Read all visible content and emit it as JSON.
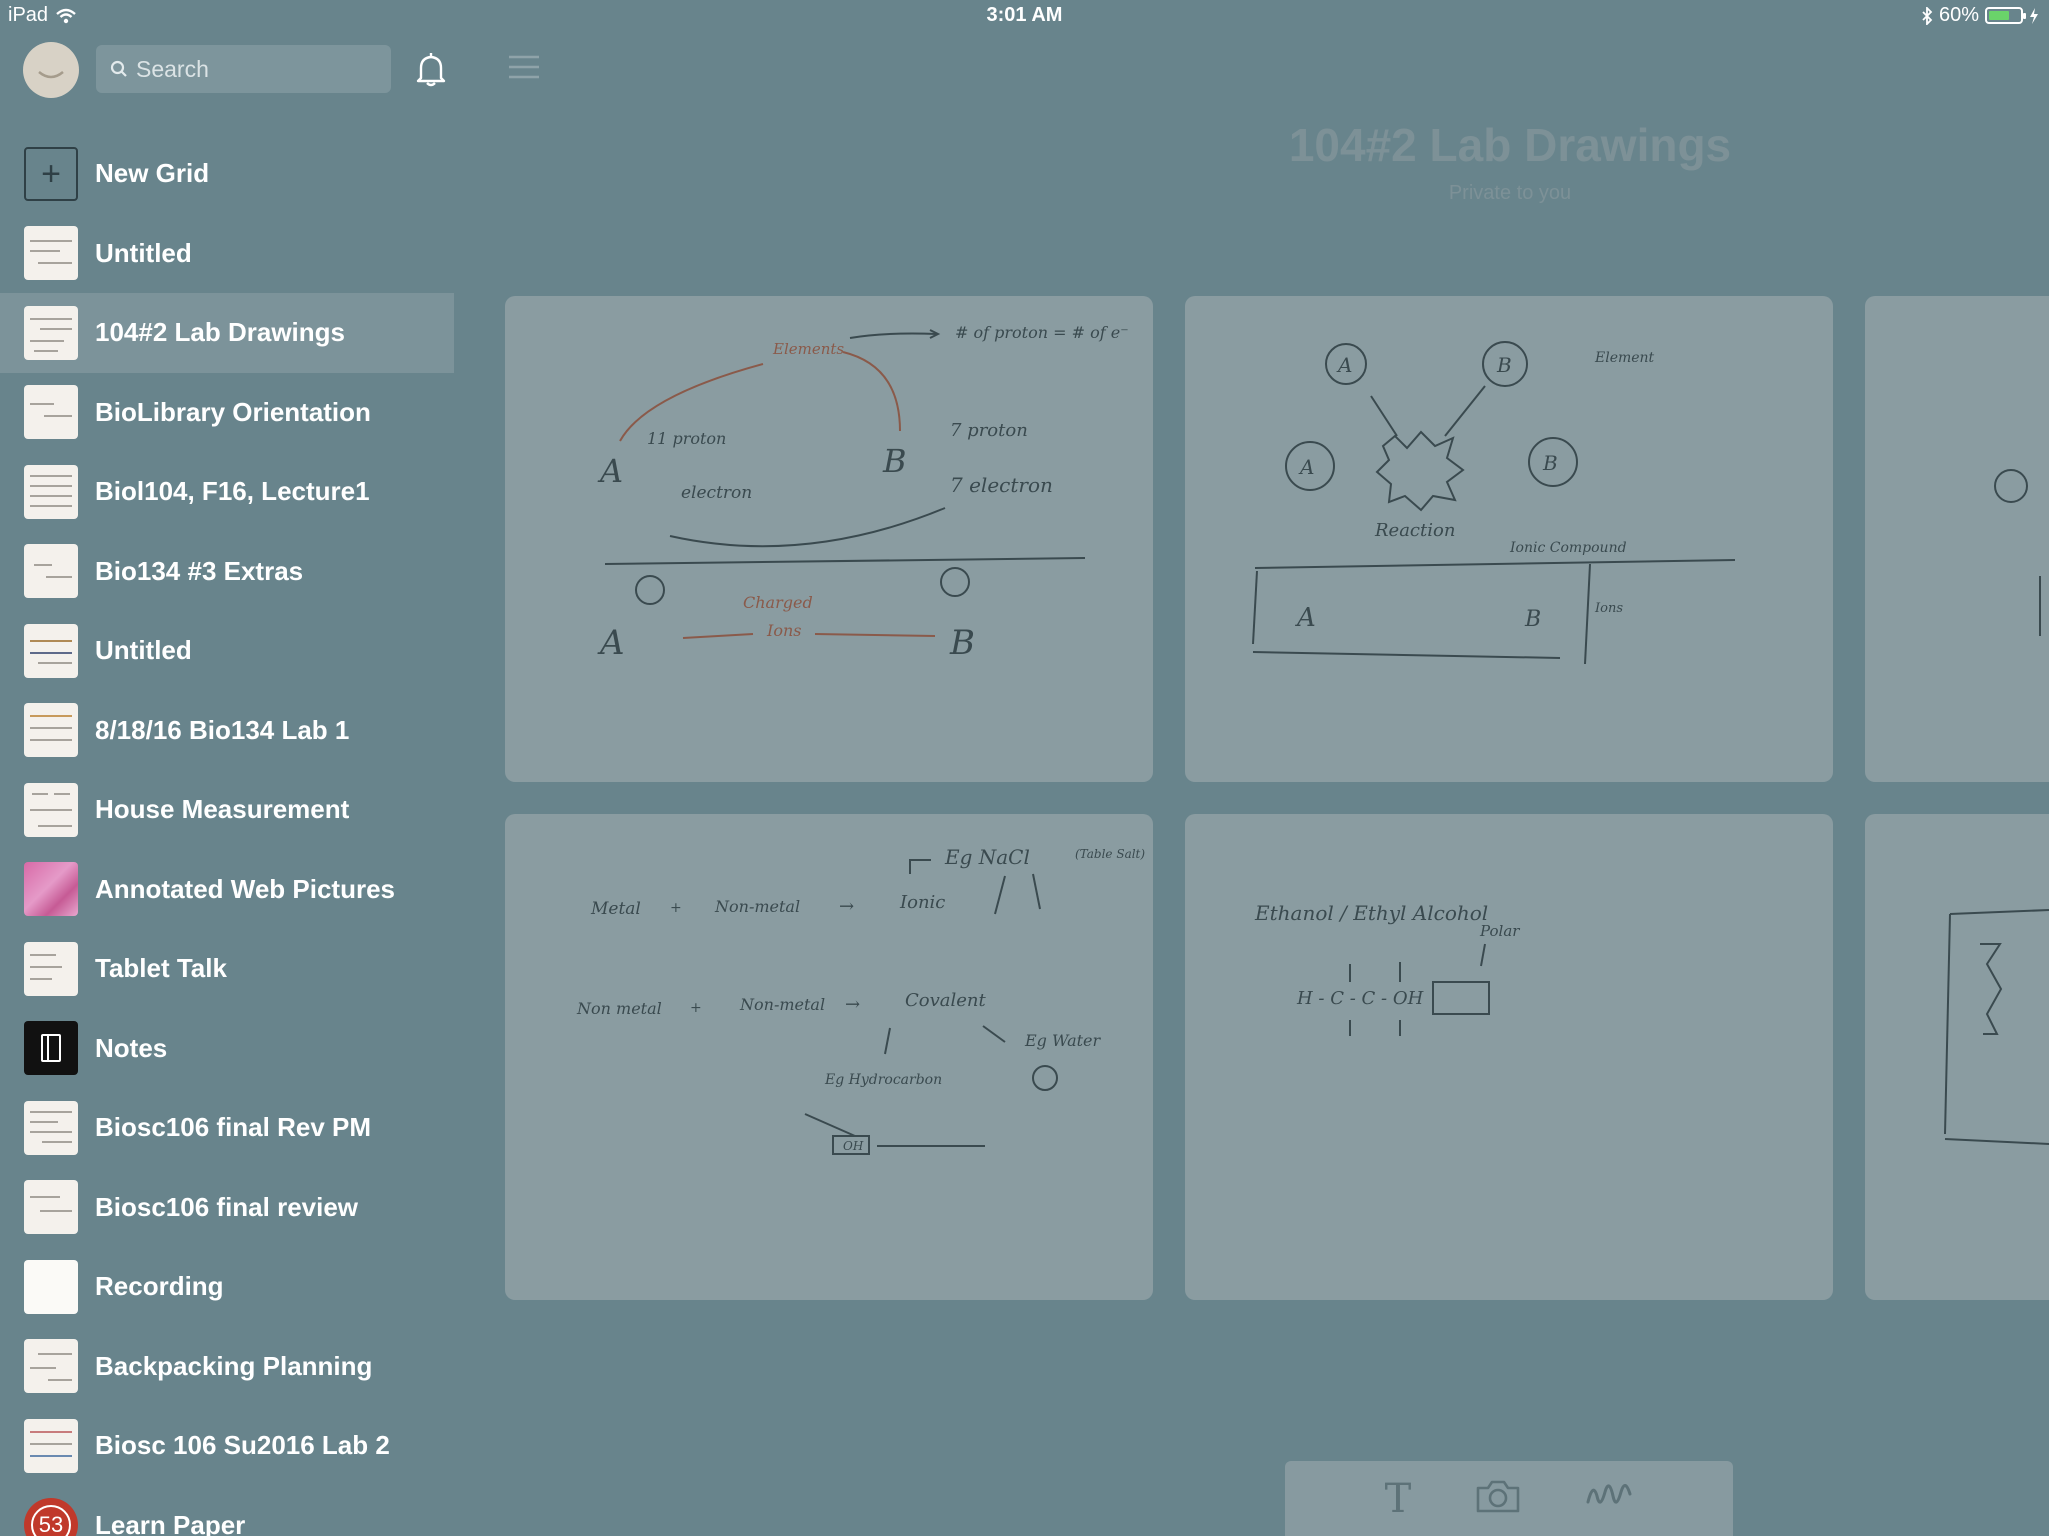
{
  "status_bar": {
    "device": "iPad",
    "time": "3:01 AM",
    "battery": "60%"
  },
  "sidebar": {
    "search_placeholder": "Search",
    "items": [
      {
        "label": "New Grid",
        "thumb": "plus"
      },
      {
        "label": "Untitled",
        "thumb": "sketch"
      },
      {
        "label": "104#2 Lab Drawings",
        "thumb": "sketch",
        "selected": true
      },
      {
        "label": "BioLibrary Orientation",
        "thumb": "sketch"
      },
      {
        "label": "Biol104, F16, Lecture1",
        "thumb": "sketch"
      },
      {
        "label": "Bio134 #3 Extras",
        "thumb": "sketch"
      },
      {
        "label": "Untitled",
        "thumb": "sketch"
      },
      {
        "label": "8/18/16 Bio134 Lab 1",
        "thumb": "sketch"
      },
      {
        "label": "House Measurement",
        "thumb": "sketch"
      },
      {
        "label": "Annotated Web Pictures",
        "thumb": "photo"
      },
      {
        "label": "Tablet Talk",
        "thumb": "sketch"
      },
      {
        "label": "Notes",
        "thumb": "notebook"
      },
      {
        "label": "Biosc106 final Rev PM",
        "thumb": "sketch"
      },
      {
        "label": "Biosc106 final review",
        "thumb": "sketch"
      },
      {
        "label": "Recording",
        "thumb": "blank"
      },
      {
        "label": "Backpacking Planning",
        "thumb": "sketch"
      },
      {
        "label": "Biosc 106 Su2016 Lab 2",
        "thumb": "sketch"
      },
      {
        "label": "Learn Paper",
        "thumb": "badge",
        "badge": "53"
      }
    ]
  },
  "main": {
    "title": "104#2 Lab Drawings",
    "subtitle": "Private to you",
    "cards": [
      {
        "texts": [
          "Elements",
          "# of proton = # of e⁻",
          "11 proton",
          "A",
          "B",
          "7 proton",
          "electron",
          "7 electron",
          "Charged",
          "Ions",
          "A",
          "B"
        ]
      },
      {
        "texts": [
          "A",
          "B",
          "Element",
          "A",
          "B",
          "Reaction",
          "Ionic Compound",
          "A",
          "B",
          "Ions"
        ]
      },
      {
        "texts": [
          "Metal",
          "+",
          "Non-metal",
          "→",
          "Ionic",
          "Eg NaCl",
          "(Table Salt)",
          "Non metal",
          "+",
          "Non-metal",
          "→",
          "Covalent",
          "Eg Hydrocarbon",
          "Eg Water",
          "OH"
        ]
      },
      {
        "texts": [
          "Ethanol / Ethyl Alcohol",
          "Polar",
          "H - C - C - OH"
        ]
      }
    ]
  },
  "toolbar": {
    "text_tool": "T",
    "camera_tool": "camera-icon",
    "draw_tool": "draw-icon"
  }
}
